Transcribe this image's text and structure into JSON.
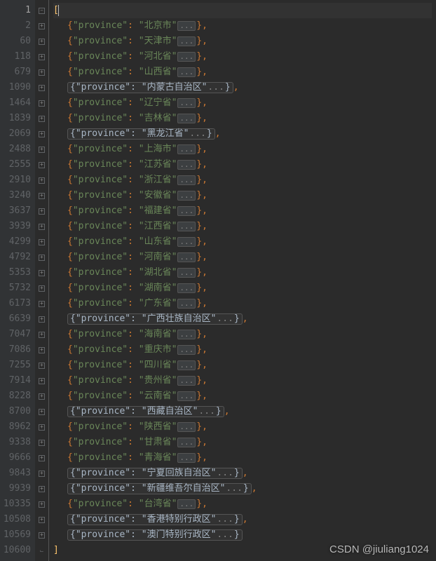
{
  "key_name": "province",
  "open_bracket": "[",
  "close_bracket": "]",
  "ellipsis": "...",
  "watermark": "CSDN @jiuliang1024",
  "lines": [
    {
      "lineno": "1",
      "type": "open",
      "fold": "minus",
      "active": true
    },
    {
      "lineno": "2",
      "type": "entry",
      "value": "北京市",
      "comma": true
    },
    {
      "lineno": "60",
      "type": "entry",
      "value": "天津市",
      "comma": true
    },
    {
      "lineno": "118",
      "type": "entry",
      "value": "河北省",
      "comma": true
    },
    {
      "lineno": "679",
      "type": "entry",
      "value": "山西省",
      "comma": true
    },
    {
      "lineno": "1090",
      "type": "entry",
      "value": "内蒙古自治区",
      "comma": true,
      "boxed": true
    },
    {
      "lineno": "1464",
      "type": "entry",
      "value": "辽宁省",
      "comma": true
    },
    {
      "lineno": "1839",
      "type": "entry",
      "value": "吉林省",
      "comma": true
    },
    {
      "lineno": "2069",
      "type": "entry",
      "value": "黑龙江省",
      "comma": true,
      "boxed": true
    },
    {
      "lineno": "2488",
      "type": "entry",
      "value": "上海市",
      "comma": true
    },
    {
      "lineno": "2555",
      "type": "entry",
      "value": "江苏省",
      "comma": true
    },
    {
      "lineno": "2910",
      "type": "entry",
      "value": "浙江省",
      "comma": true
    },
    {
      "lineno": "3240",
      "type": "entry",
      "value": "安徽省",
      "comma": true
    },
    {
      "lineno": "3637",
      "type": "entry",
      "value": "福建省",
      "comma": true
    },
    {
      "lineno": "3939",
      "type": "entry",
      "value": "江西省",
      "comma": true
    },
    {
      "lineno": "4299",
      "type": "entry",
      "value": "山东省",
      "comma": true
    },
    {
      "lineno": "4792",
      "type": "entry",
      "value": "河南省",
      "comma": true
    },
    {
      "lineno": "5353",
      "type": "entry",
      "value": "湖北省",
      "comma": true
    },
    {
      "lineno": "5732",
      "type": "entry",
      "value": "湖南省",
      "comma": true
    },
    {
      "lineno": "6173",
      "type": "entry",
      "value": "广东省",
      "comma": true
    },
    {
      "lineno": "6639",
      "type": "entry",
      "value": "广西壮族自治区",
      "comma": true,
      "boxed": true
    },
    {
      "lineno": "7047",
      "type": "entry",
      "value": "海南省",
      "comma": true
    },
    {
      "lineno": "7086",
      "type": "entry",
      "value": "重庆市",
      "comma": true
    },
    {
      "lineno": "7255",
      "type": "entry",
      "value": "四川省",
      "comma": true
    },
    {
      "lineno": "7914",
      "type": "entry",
      "value": "贵州省",
      "comma": true
    },
    {
      "lineno": "8228",
      "type": "entry",
      "value": "云南省",
      "comma": true
    },
    {
      "lineno": "8700",
      "type": "entry",
      "value": "西藏自治区",
      "comma": true,
      "boxed": true
    },
    {
      "lineno": "8962",
      "type": "entry",
      "value": "陕西省",
      "comma": true
    },
    {
      "lineno": "9338",
      "type": "entry",
      "value": "甘肃省",
      "comma": true
    },
    {
      "lineno": "9666",
      "type": "entry",
      "value": "青海省",
      "comma": true
    },
    {
      "lineno": "9843",
      "type": "entry",
      "value": "宁夏回族自治区",
      "comma": true,
      "boxed": true
    },
    {
      "lineno": "9939",
      "type": "entry",
      "value": "新疆维吾尔自治区",
      "comma": true,
      "boxed": true
    },
    {
      "lineno": "10335",
      "type": "entry",
      "value": "台湾省",
      "comma": true
    },
    {
      "lineno": "10508",
      "type": "entry",
      "value": "香港特别行政区",
      "comma": true,
      "boxed": true
    },
    {
      "lineno": "10569",
      "type": "entry",
      "value": "澳门特别行政区",
      "comma": false,
      "boxed": true
    },
    {
      "lineno": "10600",
      "type": "close",
      "fold": "close"
    }
  ]
}
